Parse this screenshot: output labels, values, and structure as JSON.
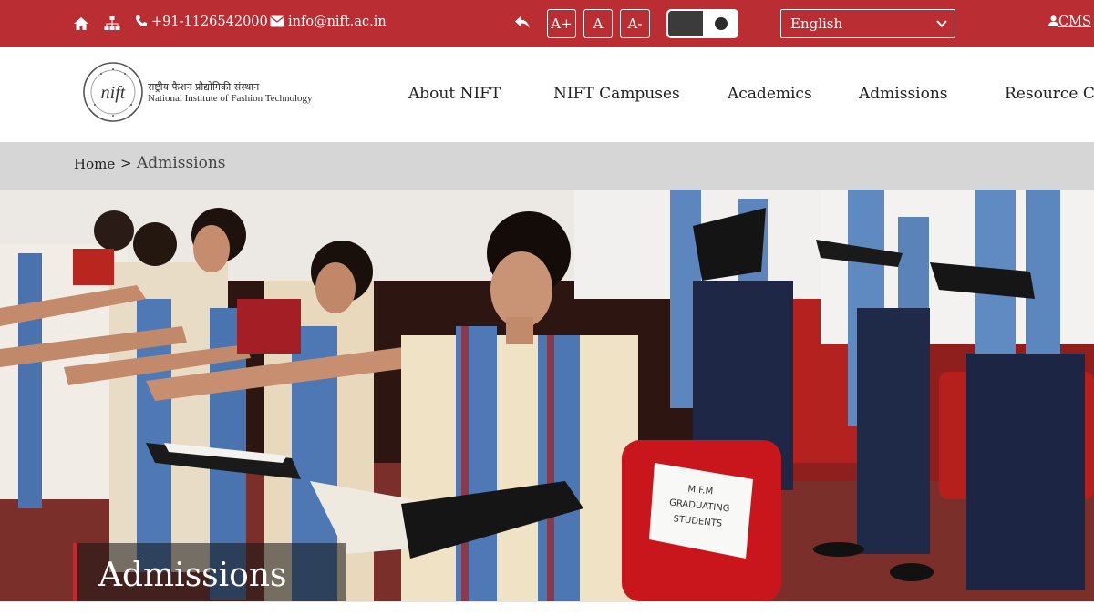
{
  "topbar": {
    "phone": "+91-1126542000",
    "email": "info@nift.ac.in",
    "font_increase": "A+",
    "font_normal": "A",
    "font_decrease": "A-",
    "language": "English",
    "login": "CMS"
  },
  "header": {
    "logo_hindi": "राष्ट्रीय फैशन प्रौद्योगिकी संस्थान",
    "logo_english": "National Institute of Fashion Technology",
    "nav": [
      "About NIFT",
      "NIFT Campuses",
      "Academics",
      "Admissions",
      "Resource Ce"
    ]
  },
  "breadcrumb": {
    "home": "Home",
    "separator": ">",
    "current": "Admissions"
  },
  "hero": {
    "title": "Admissions",
    "sign_text": [
      "M.F.M",
      "GRADUATING",
      "STUDENTS"
    ]
  },
  "colors": {
    "brand_red": "#b92d33",
    "breadcrumb_bg": "#d6d6d6"
  }
}
